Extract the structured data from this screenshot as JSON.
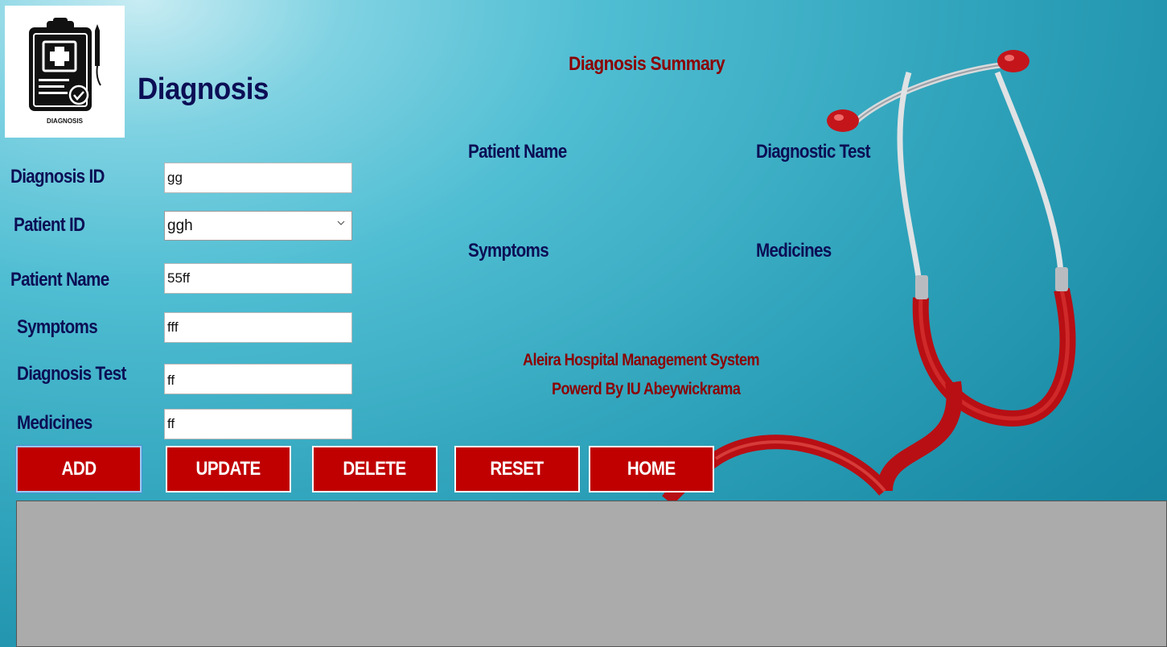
{
  "header": {
    "logo_caption": "DIAGNOSIS",
    "title": "Diagnosis"
  },
  "form": {
    "diagnosis_id": {
      "label": "Diagnosis ID",
      "value": "gg"
    },
    "patient_id": {
      "label": "Patient ID",
      "value": "ggh"
    },
    "patient_name": {
      "label": "Patient Name",
      "value": "55ff"
    },
    "symptoms": {
      "label": "Symptoms",
      "value": "fff"
    },
    "diagnosis_test": {
      "label": "Diagnosis Test",
      "value": "ff"
    },
    "medicines": {
      "label": "Medicines",
      "value": "ff"
    }
  },
  "summary": {
    "title": "Diagnosis Summary",
    "patient_name_label": "Patient Name",
    "diagnostic_test_label": "Diagnostic Test",
    "symptoms_label": "Symptoms",
    "medicines_label": "Medicines"
  },
  "footer": {
    "system_name": "Aleira Hospital Management System",
    "powered_by": "Powerd By IU Abeywickrama"
  },
  "buttons": {
    "add": "ADD",
    "update": "UPDATE",
    "delete": "DELETE",
    "reset": "RESET",
    "home": "HOME"
  },
  "icons": {
    "logo": "clipboard-medical-icon",
    "dropdown": "chevron-down-icon",
    "background": "stethoscope-icon"
  },
  "colors": {
    "label_navy": "#0c0e55",
    "accent_red": "#c00000",
    "summary_red": "#8b0000",
    "grid_gray": "#ababab"
  }
}
